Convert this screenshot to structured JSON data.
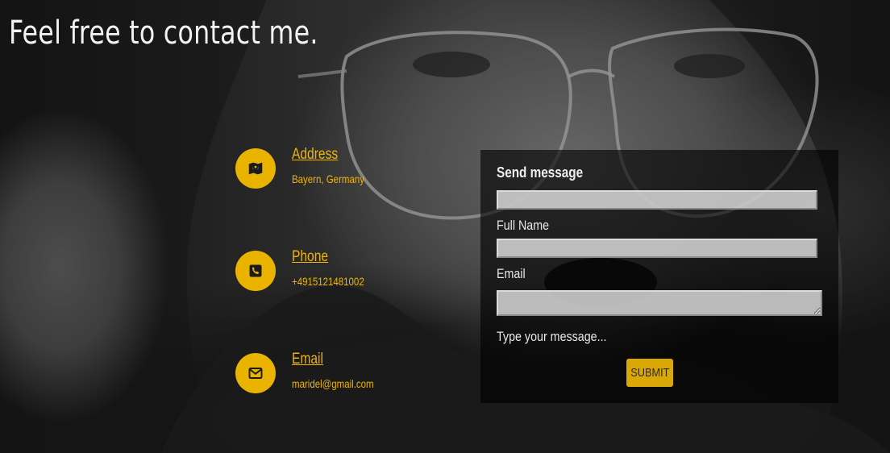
{
  "page": {
    "title": "Feel free to contact me."
  },
  "contact_info": [
    {
      "label": "Address",
      "value": "Bayern, Germany",
      "icon": "map-icon"
    },
    {
      "label": "Phone",
      "value": "+4915121481002",
      "icon": "phone-icon"
    },
    {
      "label": "Email",
      "value": "maridel@gmail.com",
      "icon": "envelope-icon"
    }
  ],
  "form": {
    "heading": "Send message",
    "name_value": "",
    "full_name_label": "Full Name",
    "email_value": "",
    "email_label": "Email",
    "message_value": "",
    "message_placeholder": "Type your message...",
    "submit_label": "SUBMIT"
  },
  "colors": {
    "accent": "#f0b400",
    "icon_circle": "#e9b300",
    "button": "#d9a706",
    "panel": "rgba(0,0,0,0.62)"
  }
}
